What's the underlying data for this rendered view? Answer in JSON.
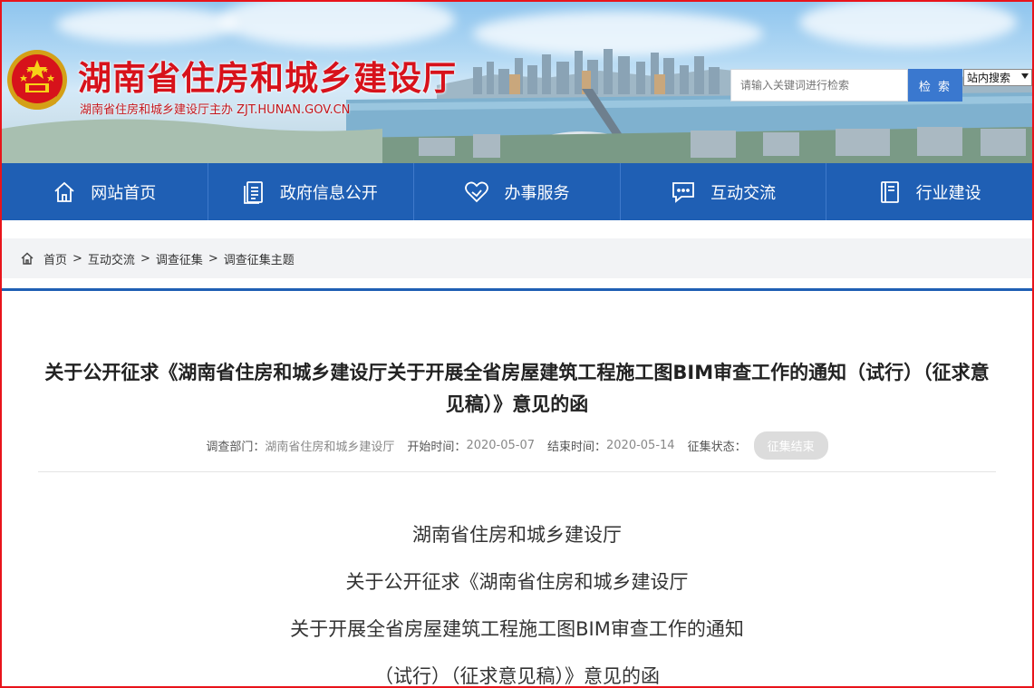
{
  "header": {
    "site_title": "湖南省住房和城乡建设厅",
    "site_subtitle": "湖南省住房和城乡建设厅主办  ZJT.HUNAN.GOV.CN",
    "search_placeholder": "请输入关键词进行检索",
    "search_button": "检 索",
    "scope_selected": "站内搜索"
  },
  "nav": {
    "items": [
      {
        "label": "网站首页",
        "icon": "home-icon"
      },
      {
        "label": "政府信息公开",
        "icon": "document-icon"
      },
      {
        "label": "办事服务",
        "icon": "heart-icon"
      },
      {
        "label": "互动交流",
        "icon": "chat-icon"
      },
      {
        "label": "行业建设",
        "icon": "book-icon"
      }
    ]
  },
  "breadcrumb": {
    "items": [
      "首页",
      "互动交流",
      "调查征集",
      "调查征集主题"
    ],
    "separator": ">"
  },
  "article": {
    "title": "关于公开征求《湖南省住房和城乡建设厅关于开展全省房屋建筑工程施工图BIM审查工作的通知（试行）（征求意见稿）》意见的函",
    "meta": {
      "dept_label": "调查部门：",
      "dept_value": "湖南省住房和城乡建设厅",
      "start_label": "开始时间：",
      "start_value": "2020-05-07",
      "end_label": "结束时间：",
      "end_value": "2020-05-14",
      "status_label": "征集状态：",
      "status_value": "征集结束"
    },
    "body_lines": [
      "湖南省住房和城乡建设厅",
      "关于公开征求《湖南省住房和城乡建设厅",
      "关于开展全省房屋建筑工程施工图BIM审查工作的通知",
      "（试行）（征求意见稿）》意见的函"
    ]
  },
  "colors": {
    "brand_red": "#d7121b",
    "nav_blue": "#1f5fb4",
    "search_blue": "#3a78cf",
    "frame_red": "#e8141b"
  }
}
